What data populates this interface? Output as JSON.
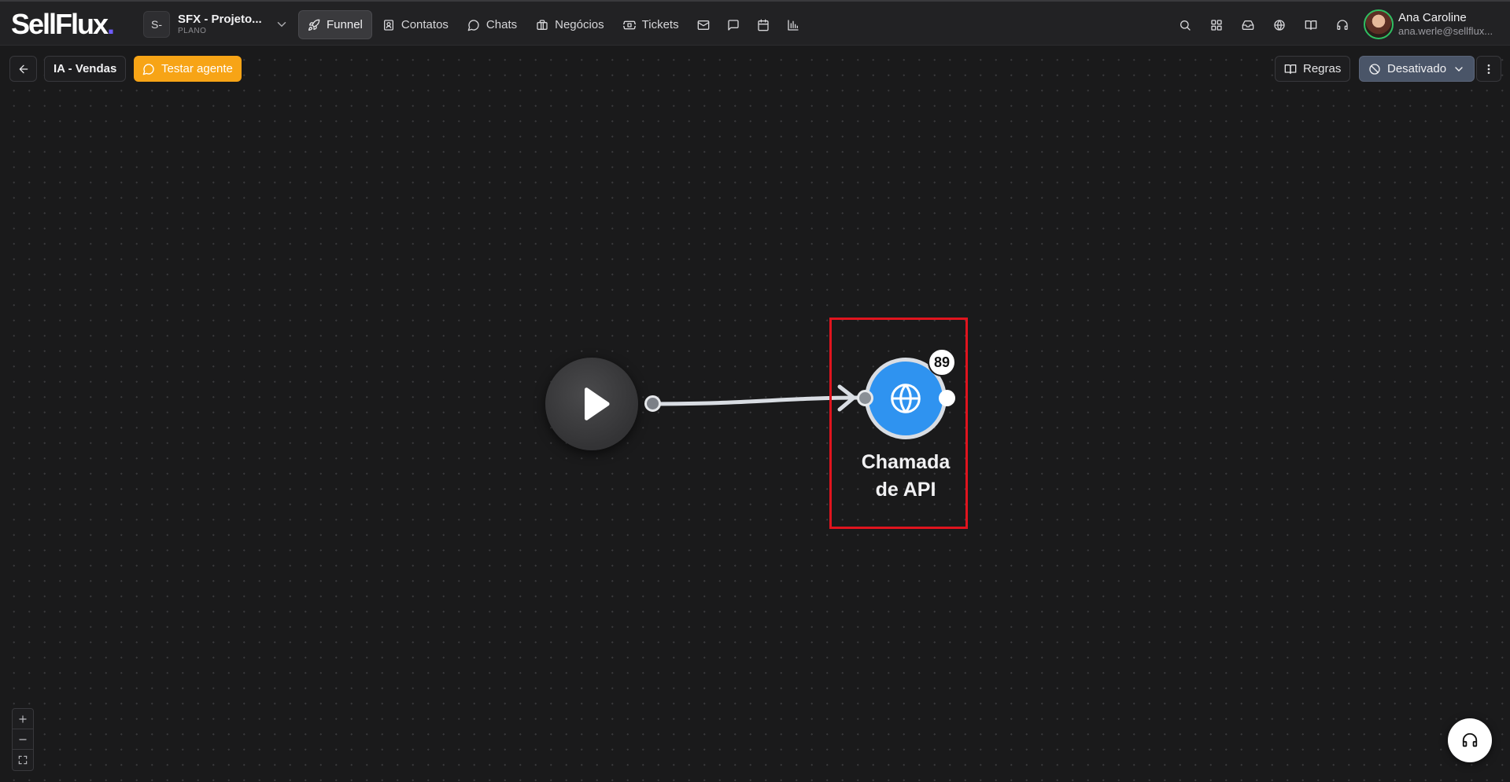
{
  "brand": {
    "logo_text": "SellFlux",
    "logo_dot": "."
  },
  "project": {
    "initial": "S-",
    "name": "SFX - Projeto...",
    "plan": "PLANO"
  },
  "nav": {
    "funnel": "Funnel",
    "contatos": "Contatos",
    "chats": "Chats",
    "negocios": "Negócios",
    "tickets": "Tickets"
  },
  "user": {
    "name": "Ana Caroline",
    "email": "ana.werle@sellflux..."
  },
  "toolbar": {
    "flow_title": "IA - Vendas",
    "test_agent": "Testar agente",
    "rules": "Regras",
    "status": "Desativado"
  },
  "nodes": {
    "api": {
      "label_line1": "Chamada",
      "label_line2": "de API",
      "count": "89"
    }
  },
  "colors": {
    "accent": "#f7a416",
    "node_blue": "#2f93f0",
    "status_bg": "#4a5568",
    "highlight": "#e0141e",
    "logo_dot": "#6f5cff"
  },
  "icons": {
    "nav": [
      "rocket-icon",
      "contacts-icon",
      "chat-bubble-icon",
      "briefcase-icon",
      "ticket-icon",
      "mail-icon",
      "message-square-icon",
      "calendar-icon",
      "bar-chart-icon"
    ],
    "right": [
      "search-icon",
      "grid-icon",
      "inbox-icon",
      "globe-icon",
      "book-icon",
      "headset-icon"
    ]
  }
}
